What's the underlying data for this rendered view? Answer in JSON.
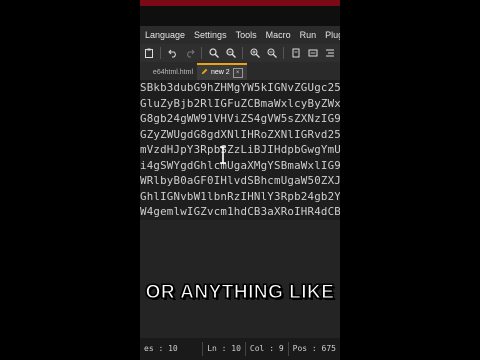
{
  "menu": {
    "items": [
      "Language",
      "Settings",
      "Tools",
      "Macro",
      "Run",
      "Plug"
    ]
  },
  "toolbar": {
    "icons": [
      "paste-icon",
      "undo-icon",
      "redo-icon",
      "find-icon",
      "find-replace-icon",
      "zoom-in-icon",
      "zoom-out-icon",
      "sync-icon",
      "wrap-icon",
      "indent-icon"
    ]
  },
  "tabs": [
    {
      "label": "e64html.html",
      "active": false
    },
    {
      "label": "new 2",
      "active": true
    }
  ],
  "editor": {
    "lines": [
      "SBkb3dubG9hZHMgYW5kIGNvZGUgc25p",
      "GluZyBjb2RlIGFuZCBmaWxlcyByZWxh",
      "G8gb24gWW91VHViZS4gVW5sZXNzIG9",
      "GZyZWUgdG8gdXNlIHRoZXNlIGRvd25s",
      "mVzdHJpY3RpbSZzLiBJIHdpbGwgYmUg",
      "i4gSWYgdGhlcmUgaXMgYSBmaWxlIG9y",
      "WRlbyB0aGF0IHlvdSBhcmUgaW50ZXJ",
      "GhlIGNvbW1lbnRzIHNlY3Rpb24gb2Yg",
      "W4gemlwIGZvcm1hdCB3aXRoIHR4dCBm"
    ]
  },
  "caption": "OR ANYTHING LIKE",
  "status": {
    "lines": "es : 10",
    "ln": "Ln : 10",
    "col": "Col : 9",
    "pos": "Pos : 675"
  }
}
